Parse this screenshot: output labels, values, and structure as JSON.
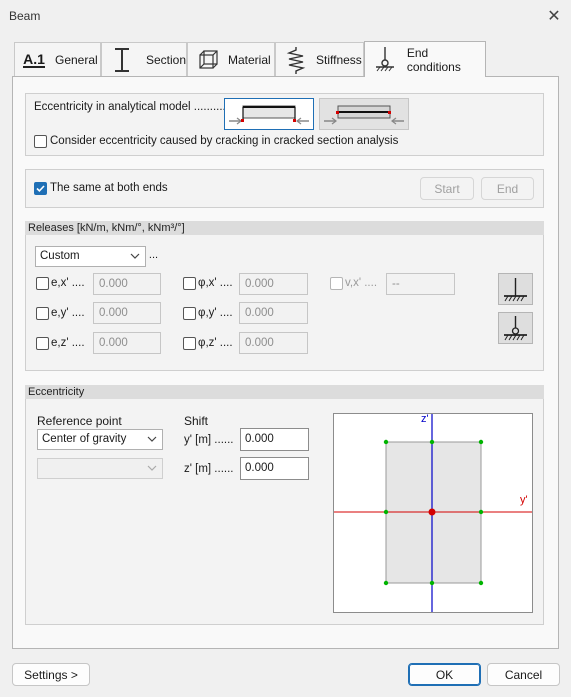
{
  "window": {
    "title": "Beam",
    "close_symbol": "✕"
  },
  "tabs": [
    {
      "id": "general",
      "label": "General",
      "icon": "a1-icon"
    },
    {
      "id": "section",
      "label": "Section",
      "icon": "i-beam-icon"
    },
    {
      "id": "material",
      "label": "Material",
      "icon": "cube-icon"
    },
    {
      "id": "stiffness",
      "label": "Stiffness",
      "icon": "spring-icon"
    },
    {
      "id": "end",
      "label": "End conditions",
      "icon": "support-icon",
      "active": true
    }
  ],
  "tab_general_glyph": "A.1",
  "eccentricity_model": {
    "label": "Eccentricity in analytical model ..........",
    "options": [
      "top-axis",
      "centroid-axis"
    ],
    "selected": "top-axis",
    "crack_label": "Consider eccentricity caused by cracking in cracked section analysis",
    "crack_checked": false
  },
  "both_ends": {
    "label": "The same at both ends",
    "checked": true,
    "start_label": "Start",
    "end_label": "End"
  },
  "releases": {
    "header": "Releases [kN/m, kNm/°, kNm³/°]",
    "preset": "Custom",
    "more": "...",
    "items": [
      {
        "label": "e,x' ....",
        "value": "0.000",
        "checked": false
      },
      {
        "label": "e,y' ....",
        "value": "0.000",
        "checked": false
      },
      {
        "label": "e,z' ....",
        "value": "0.000",
        "checked": false
      },
      {
        "label": "φ,x' ....",
        "value": "0.000",
        "checked": false
      },
      {
        "label": "φ,y' ....",
        "value": "0.000",
        "checked": false
      },
      {
        "label": "φ,z' ....",
        "value": "0.000",
        "checked": false
      },
      {
        "label": "v,x' ....",
        "value": "--",
        "checked": false,
        "disabled": true
      }
    ]
  },
  "eccentricity": {
    "header": "Eccentricity",
    "ref_label": "Reference point",
    "ref_value": "Center of gravity",
    "sub_value": "",
    "shift_label": "Shift",
    "y_label": "y' [m] ......",
    "y_value": "0.000",
    "z_label": "z' [m] ......",
    "z_value": "0.000",
    "axis_y": "y'",
    "axis_z": "z'"
  },
  "footer": {
    "settings": "Settings >",
    "ok": "OK",
    "cancel": "Cancel"
  },
  "colors": {
    "accent": "#1f6fb5",
    "axis_red": "#d40000",
    "axis_blue": "#0000c8",
    "node_green": "#00b400"
  }
}
